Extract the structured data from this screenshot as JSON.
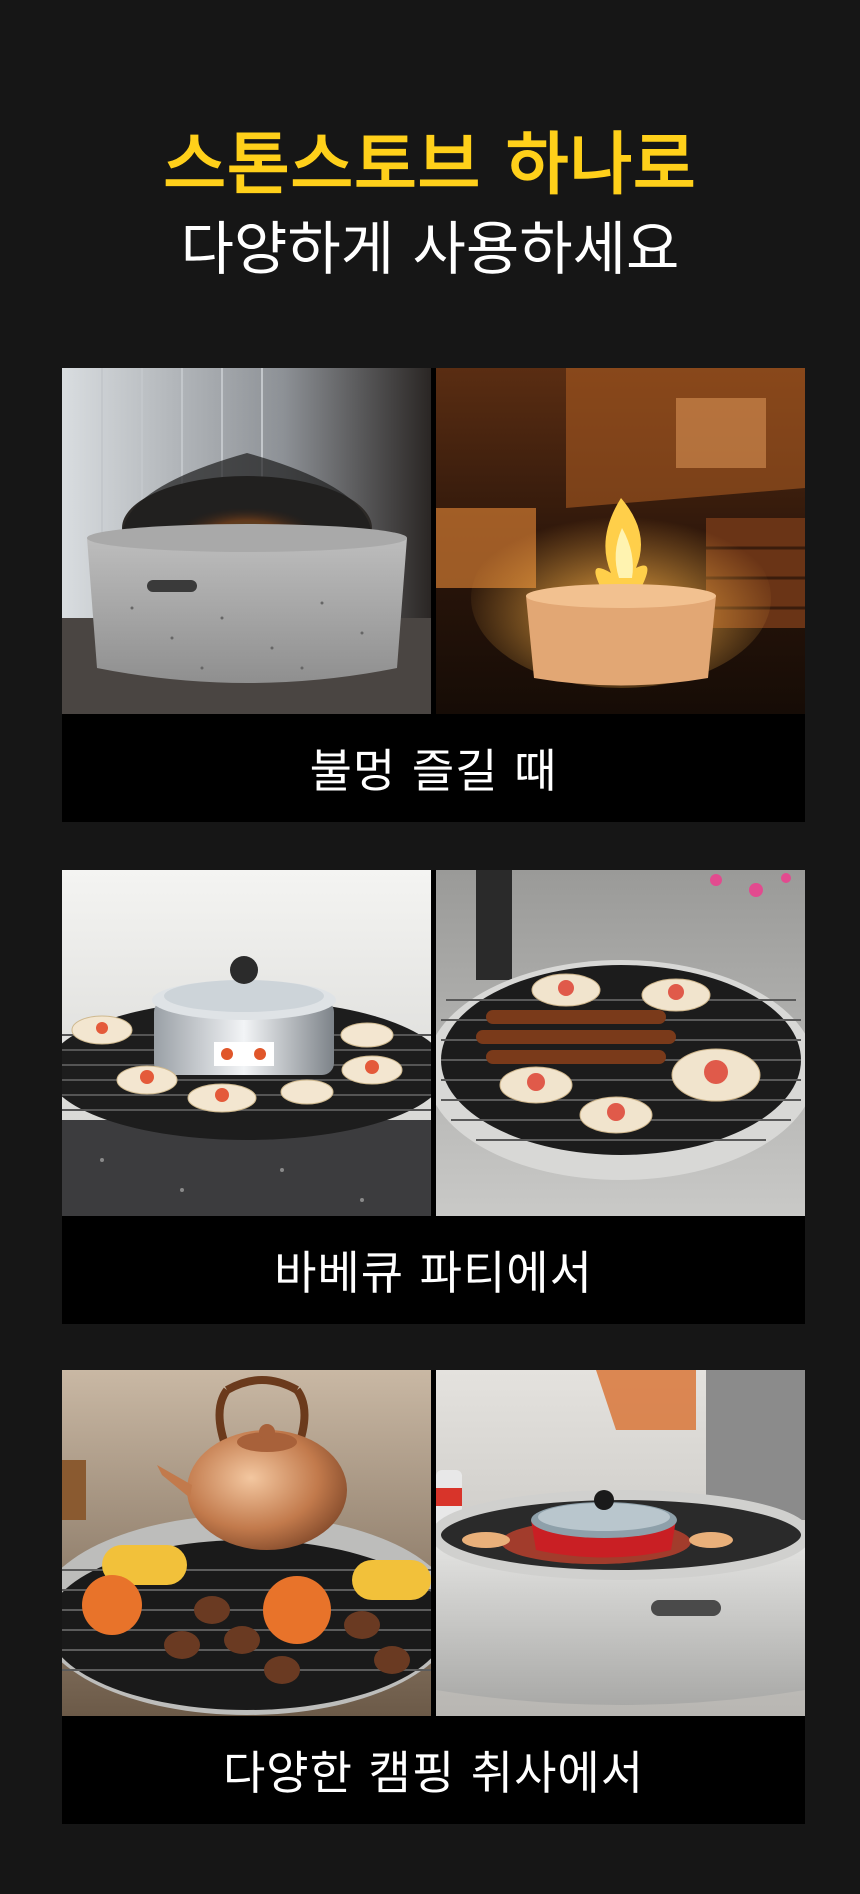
{
  "headline": {
    "line1": "스톤스토브 하나로",
    "line2": "다양하게 사용하세요"
  },
  "sections": [
    {
      "caption": "불멍 즐길 때",
      "photos": [
        "stone fire pit with mesh dome cover",
        "lit fire pit at night by campsite"
      ]
    },
    {
      "caption": "바베큐 파티에서",
      "photos": [
        "hot pot on grill with shellfish",
        "skewers and oysters on grill"
      ]
    },
    {
      "caption": "다양한 캠핑 취사에서",
      "photos": [
        "copper kettle with corn and persimmons on grill",
        "red pan on white stone stove"
      ]
    }
  ],
  "colors": {
    "background": "#161616",
    "accent": "#ffd01a",
    "caption_bg": "#000000"
  }
}
